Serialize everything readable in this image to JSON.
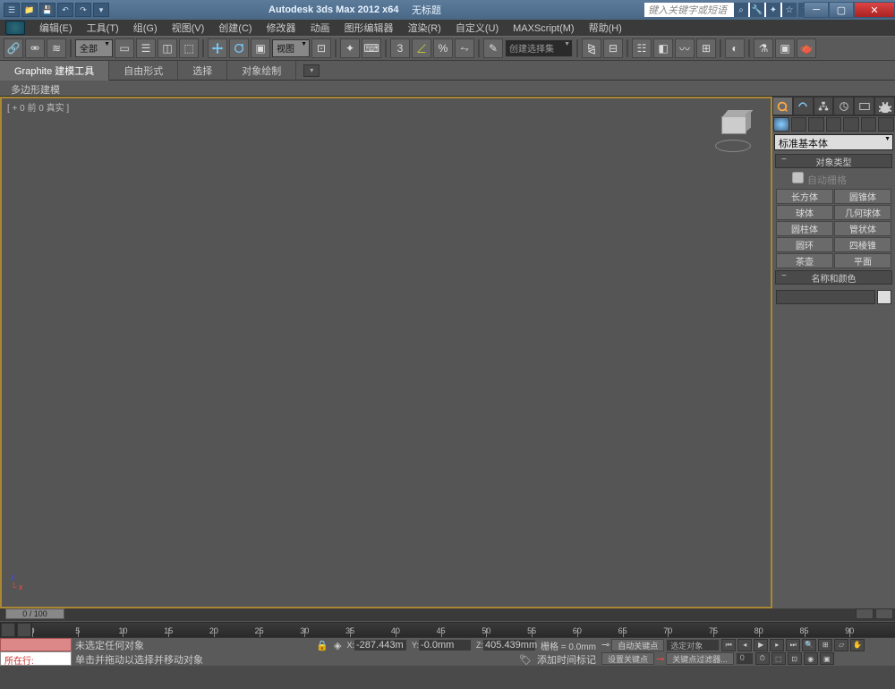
{
  "title": {
    "app": "Autodesk 3ds Max 2012 x64",
    "doc": "无标题"
  },
  "search": {
    "placeholder": "键入关键字或短语"
  },
  "menus": [
    "编辑(E)",
    "工具(T)",
    "组(G)",
    "视图(V)",
    "创建(C)",
    "修改器",
    "动画",
    "图形编辑器",
    "渲染(R)",
    "自定义(U)",
    "MAXScript(M)",
    "帮助(H)"
  ],
  "toolbar": {
    "selset_dd": "全部",
    "view_dd": "视图",
    "named_sel": "创建选择集"
  },
  "ribbon": {
    "tabs": [
      "Graphite 建模工具",
      "自由形式",
      "选择",
      "对象绘制"
    ],
    "poly": "多边形建模"
  },
  "viewport": {
    "label": "[ + 0 前 0 真实 ]"
  },
  "panel": {
    "dd": "标准基本体",
    "rollout1": "对象类型",
    "autogrid": "自动栅格",
    "objects": [
      "长方体",
      "圆锥体",
      "球体",
      "几何球体",
      "圆柱体",
      "管状体",
      "圆环",
      "四棱锥",
      "茶壶",
      "平面"
    ],
    "rollout2": "名称和颜色"
  },
  "timeline": {
    "slider": "0 / 100",
    "ticks": [
      0,
      5,
      10,
      15,
      20,
      25,
      30,
      35,
      40,
      45,
      50,
      55,
      60,
      65,
      70,
      75,
      80,
      85,
      90
    ]
  },
  "status": {
    "nowplaying": "所在行:",
    "sel": "未选定任何对象",
    "hint": "单击并拖动以选择并移动对象",
    "addtag": "添加时间标记",
    "coords": {
      "x": "-287.443m",
      "y": "-0.0mm",
      "z": "405.439mm"
    },
    "grid": "栅格 = 0.0mm",
    "autokey": "自动关键点",
    "selobj": "选定对象",
    "setkey": "设置关键点",
    "keyfilter": "关键点过滤器..."
  }
}
